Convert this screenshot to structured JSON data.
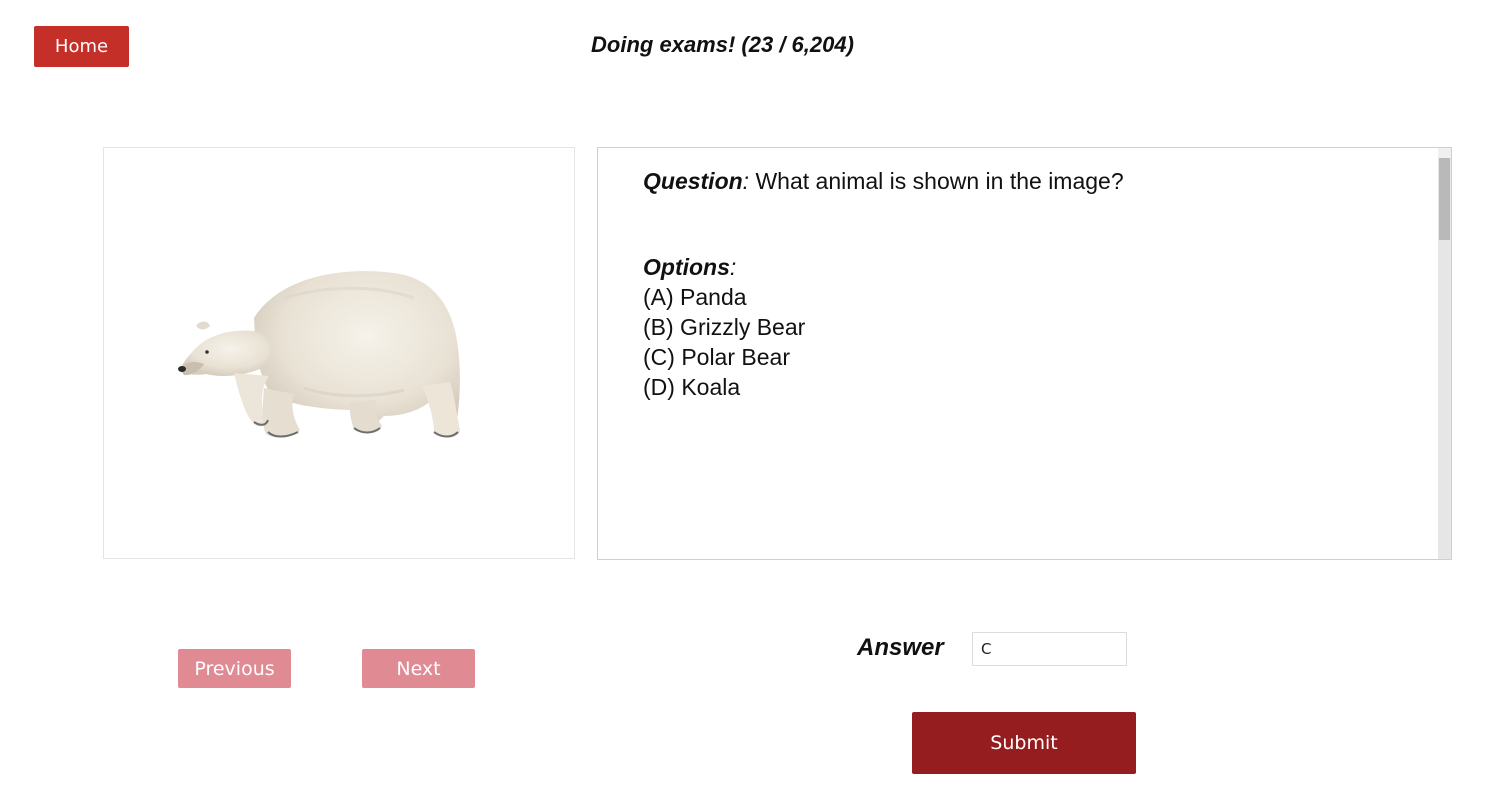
{
  "header": {
    "home_label": "Home",
    "title": "Doing exams! (23 / 6,204)"
  },
  "image_panel": {
    "icon": "polar-bear-image"
  },
  "question": {
    "label": "Question",
    "text": " What animal is shown in the image?",
    "options_label": "Options",
    "options": [
      "(A) Panda",
      "(B) Grizzly Bear",
      "(C) Polar Bear",
      "(D) Koala"
    ]
  },
  "navigation": {
    "previous_label": "Previous",
    "next_label": "Next"
  },
  "answer": {
    "label": "Answer",
    "value": "C"
  },
  "submit": {
    "label": "Submit"
  },
  "colors": {
    "home_button": "#c42f27",
    "nav_button": "#e08a94",
    "submit_button": "#961d1f"
  }
}
